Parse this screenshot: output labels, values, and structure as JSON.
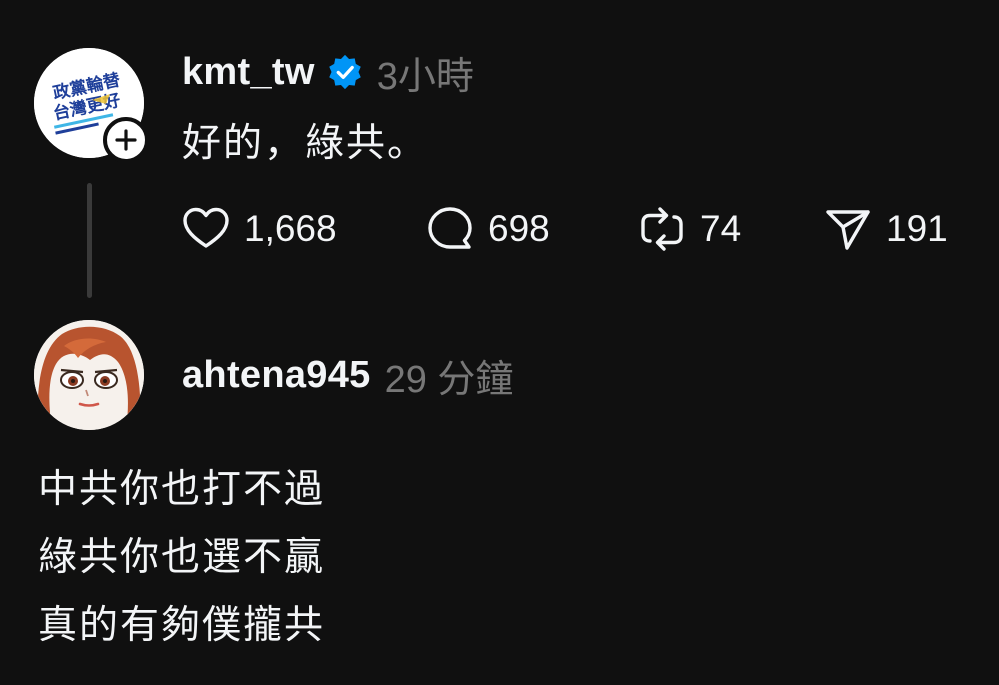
{
  "post": {
    "avatar_text": {
      "line1": "政黨輪替",
      "line2": "台灣更好"
    },
    "username": "kmt_tw",
    "time": "3小時",
    "text": "好的，綠共。",
    "icons": {
      "follow": "plus-icon",
      "verified": "verified-badge-icon",
      "like": "heart-icon",
      "reply": "comment-bubble-icon",
      "repost": "repost-icon",
      "share": "send-icon"
    },
    "stats": {
      "likes": "1,668",
      "replies": "698",
      "reposts": "74",
      "shares": "191"
    }
  },
  "reply": {
    "username": "ahtena945",
    "time": "29 分鐘",
    "lines": [
      "中共你也打不過",
      "綠共你也選不贏",
      "真的有夠僕攏共"
    ]
  },
  "colors": {
    "background": "#101010",
    "text": "#f3f5f7",
    "muted": "#777777",
    "verified": "#0095f6",
    "thread_line": "#3a3a3a"
  }
}
